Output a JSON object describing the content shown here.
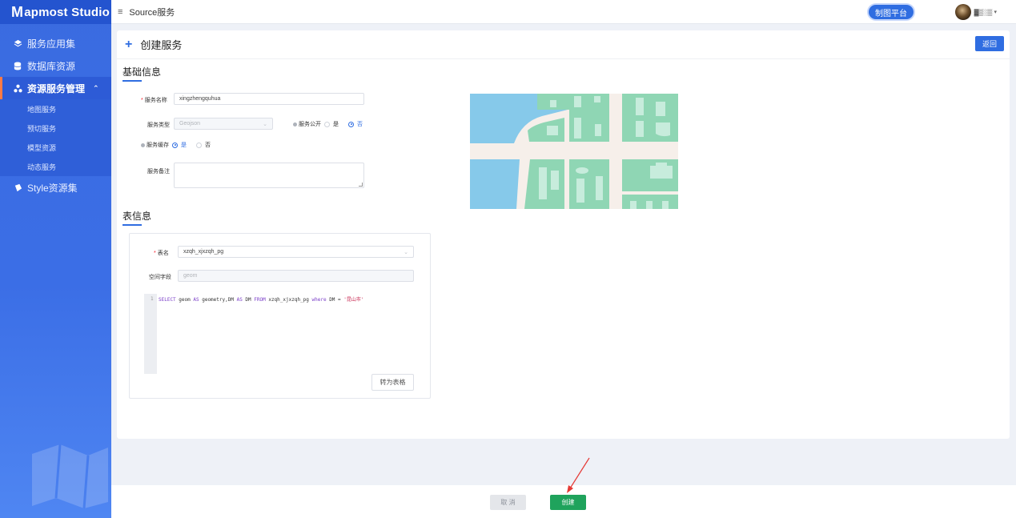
{
  "app": {
    "logo_m": "M",
    "logo_rest": "apmost Studio"
  },
  "topbar": {
    "menu_toggle_icon": "≡",
    "breadcrumb": "Source服务",
    "platform_button": "制图平台",
    "user_name": "▓▒░▒",
    "user_caret": "▾"
  },
  "sidebar": {
    "items": [
      {
        "label": "服务应用集",
        "icon": "layers-icon"
      },
      {
        "label": "数据库资源",
        "icon": "database-icon"
      },
      {
        "label": "资源服务管理",
        "icon": "cluster-icon",
        "chevron": "⌃"
      },
      {
        "label": "Style资源集",
        "icon": "bucket-icon"
      }
    ],
    "subitems": [
      "地图服务",
      "预切服务",
      "模型资源",
      "动态服务"
    ]
  },
  "page": {
    "title": "创建服务",
    "back_button": "返回"
  },
  "basic": {
    "section_title": "基础信息",
    "name_label": "服务名称",
    "name_value": "xingzhengquhua",
    "type_label": "服务类型",
    "type_value": "Geojson",
    "public_label": "服务公开",
    "cache_label": "服务缓存",
    "remark_label": "服务备注",
    "yes": "是",
    "no": "否"
  },
  "table_info": {
    "section_title": "表信息",
    "table_label": "表名",
    "table_value": "xzqh_xjxzqh_pg",
    "field_label": "空间字段",
    "field_placeholder": "geom",
    "code_line_no": "1",
    "code": {
      "kw1": "SELECT",
      "p1": " geom ",
      "kw2": "AS",
      "p2": " geometry,DM ",
      "kw3": "AS",
      "p3": " DM ",
      "kw4": "FROM",
      "p4": " xzqh_xjxzqh_pg ",
      "kw5": "where",
      "p5": " DM = ",
      "str": "'昆山市'"
    },
    "convert_button": "转为表格"
  },
  "footer": {
    "cancel": "取 消",
    "create": "创建"
  },
  "colors": {
    "primary": "#2f6de1",
    "success": "#1fa35c",
    "map_water": "#86c9ea",
    "map_block": "#8fd6b4",
    "map_road": "#f6efea"
  }
}
